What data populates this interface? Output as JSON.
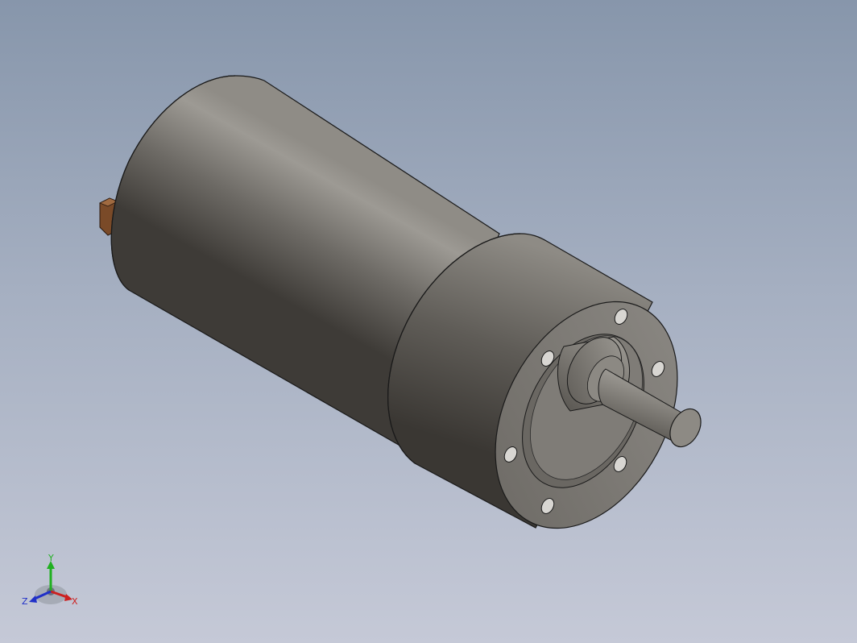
{
  "viewport": {
    "background_top": "#8796ab",
    "background_bottom": "#c5c9d7"
  },
  "model": {
    "body_color": "#7d7a74",
    "body_highlight": "#a19e98",
    "body_shadow": "#3f3c38",
    "terminal_color": "#7a4a28",
    "flange_holes": 6
  },
  "triad": {
    "x_label": "X",
    "y_label": "Y",
    "z_label": "Z",
    "x_color": "#cc2020",
    "y_color": "#20b020",
    "z_color": "#2030c8"
  }
}
